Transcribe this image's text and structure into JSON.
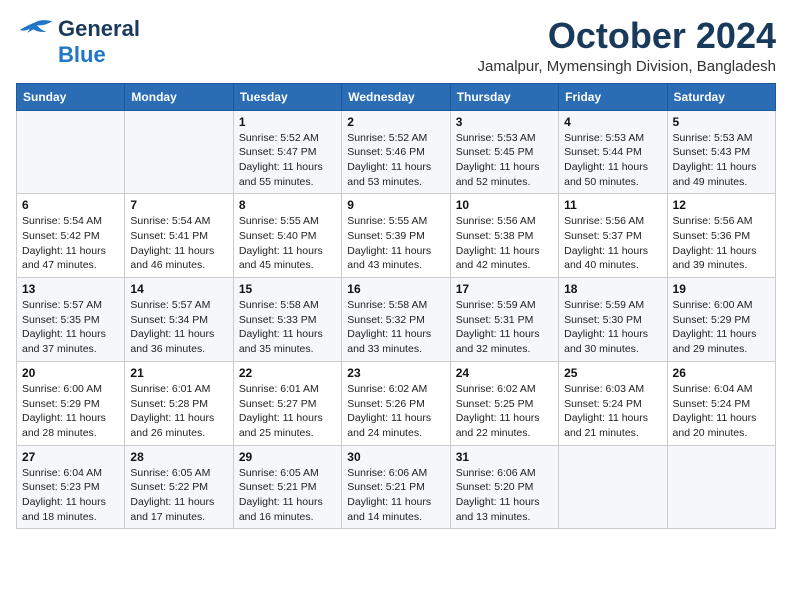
{
  "header": {
    "logo_line1": "General",
    "logo_line2": "Blue",
    "title": "October 2024",
    "location": "Jamalpur, Mymensingh Division, Bangladesh"
  },
  "weekdays": [
    "Sunday",
    "Monday",
    "Tuesday",
    "Wednesday",
    "Thursday",
    "Friday",
    "Saturday"
  ],
  "weeks": [
    [
      {
        "day": "",
        "info": ""
      },
      {
        "day": "",
        "info": ""
      },
      {
        "day": "1",
        "info": "Sunrise: 5:52 AM\nSunset: 5:47 PM\nDaylight: 11 hours\nand 55 minutes."
      },
      {
        "day": "2",
        "info": "Sunrise: 5:52 AM\nSunset: 5:46 PM\nDaylight: 11 hours\nand 53 minutes."
      },
      {
        "day": "3",
        "info": "Sunrise: 5:53 AM\nSunset: 5:45 PM\nDaylight: 11 hours\nand 52 minutes."
      },
      {
        "day": "4",
        "info": "Sunrise: 5:53 AM\nSunset: 5:44 PM\nDaylight: 11 hours\nand 50 minutes."
      },
      {
        "day": "5",
        "info": "Sunrise: 5:53 AM\nSunset: 5:43 PM\nDaylight: 11 hours\nand 49 minutes."
      }
    ],
    [
      {
        "day": "6",
        "info": "Sunrise: 5:54 AM\nSunset: 5:42 PM\nDaylight: 11 hours\nand 47 minutes."
      },
      {
        "day": "7",
        "info": "Sunrise: 5:54 AM\nSunset: 5:41 PM\nDaylight: 11 hours\nand 46 minutes."
      },
      {
        "day": "8",
        "info": "Sunrise: 5:55 AM\nSunset: 5:40 PM\nDaylight: 11 hours\nand 45 minutes."
      },
      {
        "day": "9",
        "info": "Sunrise: 5:55 AM\nSunset: 5:39 PM\nDaylight: 11 hours\nand 43 minutes."
      },
      {
        "day": "10",
        "info": "Sunrise: 5:56 AM\nSunset: 5:38 PM\nDaylight: 11 hours\nand 42 minutes."
      },
      {
        "day": "11",
        "info": "Sunrise: 5:56 AM\nSunset: 5:37 PM\nDaylight: 11 hours\nand 40 minutes."
      },
      {
        "day": "12",
        "info": "Sunrise: 5:56 AM\nSunset: 5:36 PM\nDaylight: 11 hours\nand 39 minutes."
      }
    ],
    [
      {
        "day": "13",
        "info": "Sunrise: 5:57 AM\nSunset: 5:35 PM\nDaylight: 11 hours\nand 37 minutes."
      },
      {
        "day": "14",
        "info": "Sunrise: 5:57 AM\nSunset: 5:34 PM\nDaylight: 11 hours\nand 36 minutes."
      },
      {
        "day": "15",
        "info": "Sunrise: 5:58 AM\nSunset: 5:33 PM\nDaylight: 11 hours\nand 35 minutes."
      },
      {
        "day": "16",
        "info": "Sunrise: 5:58 AM\nSunset: 5:32 PM\nDaylight: 11 hours\nand 33 minutes."
      },
      {
        "day": "17",
        "info": "Sunrise: 5:59 AM\nSunset: 5:31 PM\nDaylight: 11 hours\nand 32 minutes."
      },
      {
        "day": "18",
        "info": "Sunrise: 5:59 AM\nSunset: 5:30 PM\nDaylight: 11 hours\nand 30 minutes."
      },
      {
        "day": "19",
        "info": "Sunrise: 6:00 AM\nSunset: 5:29 PM\nDaylight: 11 hours\nand 29 minutes."
      }
    ],
    [
      {
        "day": "20",
        "info": "Sunrise: 6:00 AM\nSunset: 5:29 PM\nDaylight: 11 hours\nand 28 minutes."
      },
      {
        "day": "21",
        "info": "Sunrise: 6:01 AM\nSunset: 5:28 PM\nDaylight: 11 hours\nand 26 minutes."
      },
      {
        "day": "22",
        "info": "Sunrise: 6:01 AM\nSunset: 5:27 PM\nDaylight: 11 hours\nand 25 minutes."
      },
      {
        "day": "23",
        "info": "Sunrise: 6:02 AM\nSunset: 5:26 PM\nDaylight: 11 hours\nand 24 minutes."
      },
      {
        "day": "24",
        "info": "Sunrise: 6:02 AM\nSunset: 5:25 PM\nDaylight: 11 hours\nand 22 minutes."
      },
      {
        "day": "25",
        "info": "Sunrise: 6:03 AM\nSunset: 5:24 PM\nDaylight: 11 hours\nand 21 minutes."
      },
      {
        "day": "26",
        "info": "Sunrise: 6:04 AM\nSunset: 5:24 PM\nDaylight: 11 hours\nand 20 minutes."
      }
    ],
    [
      {
        "day": "27",
        "info": "Sunrise: 6:04 AM\nSunset: 5:23 PM\nDaylight: 11 hours\nand 18 minutes."
      },
      {
        "day": "28",
        "info": "Sunrise: 6:05 AM\nSunset: 5:22 PM\nDaylight: 11 hours\nand 17 minutes."
      },
      {
        "day": "29",
        "info": "Sunrise: 6:05 AM\nSunset: 5:21 PM\nDaylight: 11 hours\nand 16 minutes."
      },
      {
        "day": "30",
        "info": "Sunrise: 6:06 AM\nSunset: 5:21 PM\nDaylight: 11 hours\nand 14 minutes."
      },
      {
        "day": "31",
        "info": "Sunrise: 6:06 AM\nSunset: 5:20 PM\nDaylight: 11 hours\nand 13 minutes."
      },
      {
        "day": "",
        "info": ""
      },
      {
        "day": "",
        "info": ""
      }
    ]
  ]
}
